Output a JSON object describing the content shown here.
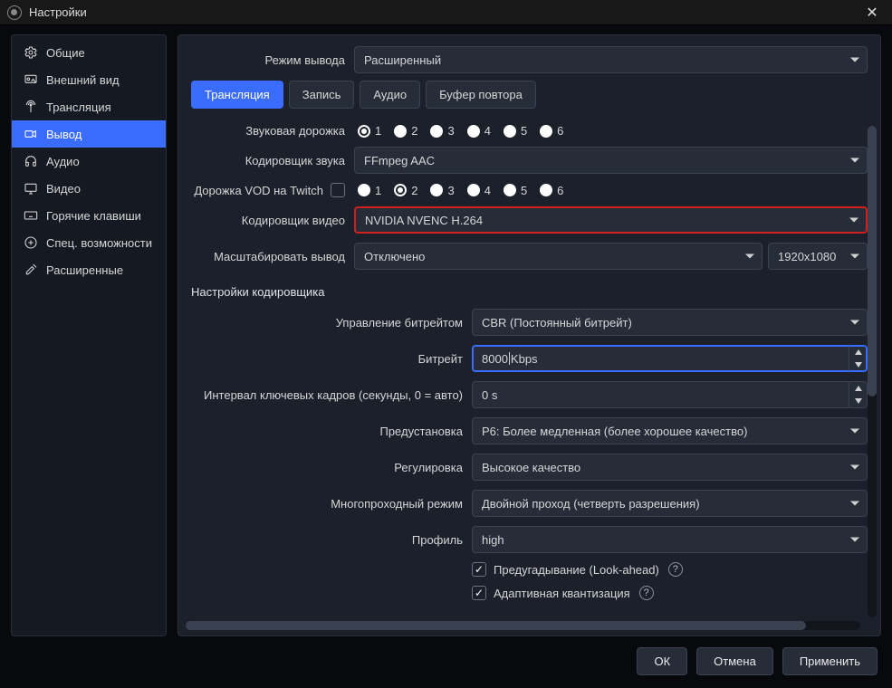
{
  "window": {
    "title": "Настройки"
  },
  "sidebar": {
    "items": [
      {
        "id": "general",
        "label": "Общие",
        "icon": "gear-icon"
      },
      {
        "id": "appearance",
        "label": "Внешний вид",
        "icon": "appearance-icon"
      },
      {
        "id": "stream",
        "label": "Трансляция",
        "icon": "antenna-icon"
      },
      {
        "id": "output",
        "label": "Вывод",
        "icon": "output-icon",
        "active": true
      },
      {
        "id": "audio",
        "label": "Аудио",
        "icon": "headphones-icon"
      },
      {
        "id": "video",
        "label": "Видео",
        "icon": "display-icon"
      },
      {
        "id": "hotkeys",
        "label": "Горячие клавиши",
        "icon": "keyboard-icon"
      },
      {
        "id": "access",
        "label": "Спец. возможности",
        "icon": "plus-circle-icon"
      },
      {
        "id": "advanced",
        "label": "Расширенные",
        "icon": "tools-icon"
      }
    ]
  },
  "output_mode": {
    "label": "Режим вывода",
    "value": "Расширенный"
  },
  "tabs": [
    "Трансляция",
    "Запись",
    "Аудио",
    "Буфер повтора"
  ],
  "active_tab": 0,
  "stream": {
    "audio_track_label": "Звуковая дорожка",
    "audio_track_options": [
      "1",
      "2",
      "3",
      "4",
      "5",
      "6"
    ],
    "audio_track_selected": 0,
    "audio_encoder_label": "Кодировщик звука",
    "audio_encoder_value": "FFmpeg AAC",
    "twitch_vod_label": "Дорожка VOD на Twitch",
    "twitch_vod_checked": false,
    "twitch_vod_options": [
      "1",
      "2",
      "3",
      "4",
      "5",
      "6"
    ],
    "twitch_vod_selected": 1,
    "video_encoder_label": "Кодировщик видео",
    "video_encoder_value": "NVIDIA NVENC H.264",
    "rescale_label": "Масштабировать вывод",
    "rescale_value": "Отключено",
    "rescale_resolution": "1920x1080"
  },
  "encoder": {
    "section_title": "Настройки кодировщика",
    "rate_control_label": "Управление битрейтом",
    "rate_control_value": "CBR (Постоянный битрейт)",
    "bitrate_label": "Битрейт",
    "bitrate_value": "8000",
    "bitrate_unit": "Kbps",
    "keyint_label": "Интервал ключевых кадров (секунды, 0 = авто)",
    "keyint_value": "0 s",
    "preset_label": "Предустановка",
    "preset_value": "P6: Более медленная (более хорошее качество)",
    "tuning_label": "Регулировка",
    "tuning_value": "Высокое качество",
    "multipass_label": "Многопроходный режим",
    "multipass_value": "Двойной проход (четверть разрешения)",
    "profile_label": "Профиль",
    "profile_value": "high",
    "lookahead_label": "Предугадывание (Look-ahead)",
    "lookahead_checked": true,
    "psycho_aq_label": "Адаптивная квантизация",
    "psycho_aq_checked": true
  },
  "footer": {
    "ok": "ОК",
    "cancel": "Отмена",
    "apply": "Применить"
  }
}
